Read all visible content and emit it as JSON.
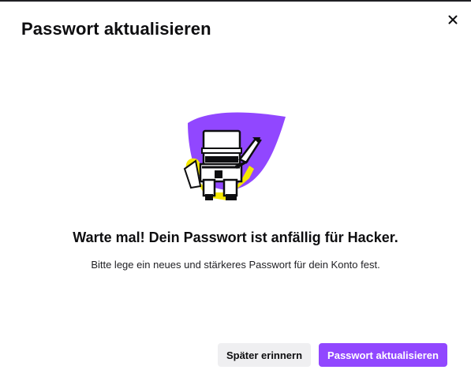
{
  "dialog": {
    "title": "Passwort aktualisieren",
    "close_icon": "close-icon",
    "illustration": "knight-with-sword-illustration",
    "headline": "Warte mal! Dein Passwort ist anfällig für Hacker.",
    "message": "Bitte lege ein neues und stärkeres Passwort für dein Konto fest.",
    "buttons": {
      "remind_later": "Später erinnern",
      "update_password": "Passwort aktualisieren"
    }
  },
  "colors": {
    "accent": "#9147ff",
    "secondary_button_bg": "#efeff1",
    "text": "#0e0e10",
    "highlight_yellow": "#f5e800"
  }
}
